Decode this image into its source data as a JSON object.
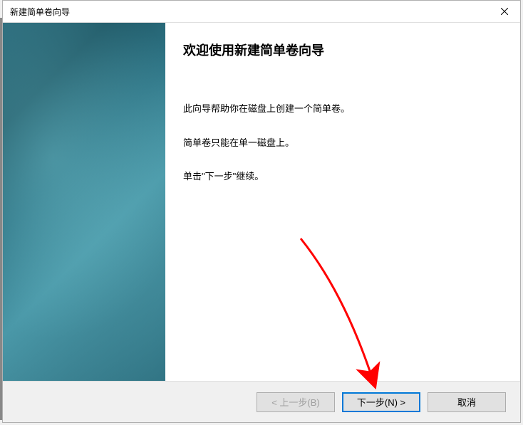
{
  "titlebar": {
    "title": "新建简单卷向导"
  },
  "wizard": {
    "heading": "欢迎使用新建简单卷向导",
    "line1": "此向导帮助你在磁盘上创建一个简单卷。",
    "line2": "简单卷只能在单一磁盘上。",
    "line3": "单击\"下一步\"继续。"
  },
  "buttons": {
    "back": "< 上一步(B)",
    "next": "下一步(N) >",
    "cancel": "取消"
  }
}
